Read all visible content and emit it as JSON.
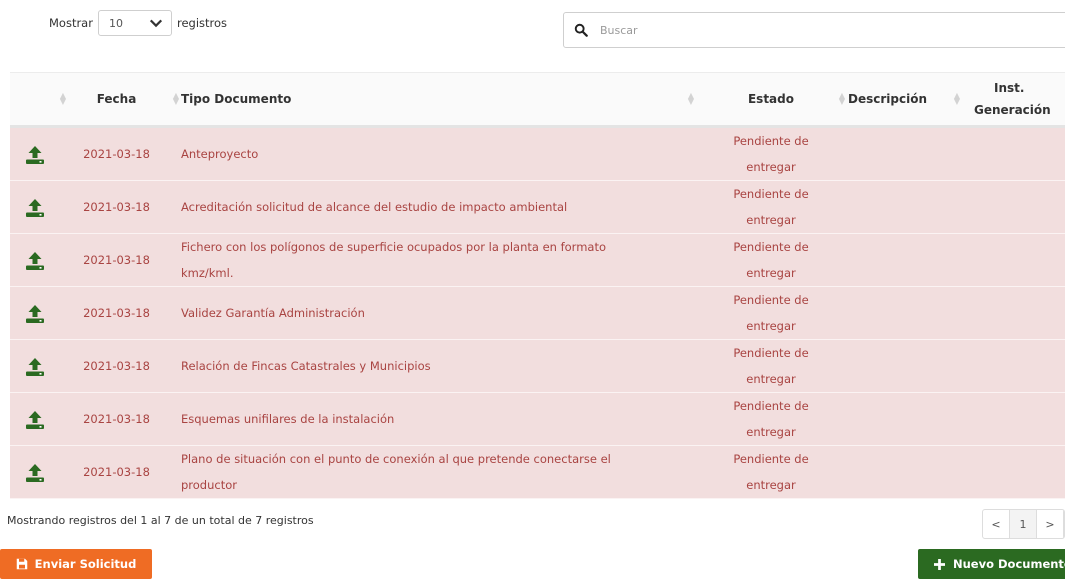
{
  "length_menu": {
    "prefix": "Mostrar",
    "value": "10",
    "suffix": "registros"
  },
  "search": {
    "placeholder": "Buscar"
  },
  "table": {
    "headers": {
      "fecha": "Fecha",
      "tipo": "Tipo Documento",
      "estado": "Estado",
      "descripcion": "Descripción",
      "inst_line1": "Inst.",
      "inst_line2": "Generación"
    },
    "rows": [
      {
        "fecha": "2021-03-18",
        "tipo": "Anteproyecto",
        "estado_l1": "Pendiente de",
        "estado_l2": "entregar"
      },
      {
        "fecha": "2021-03-18",
        "tipo": "Acreditación solicitud de alcance del estudio de impacto ambiental",
        "estado_l1": "Pendiente de",
        "estado_l2": "entregar"
      },
      {
        "fecha": "2021-03-18",
        "tipo_l1": "Fichero con los polígonos de superficie ocupados por la planta en formato",
        "tipo_l2": "kmz/kml.",
        "estado_l1": "Pendiente de",
        "estado_l2": "entregar"
      },
      {
        "fecha": "2021-03-18",
        "tipo": "Validez Garantía Administración",
        "estado_l1": "Pendiente de",
        "estado_l2": "entregar"
      },
      {
        "fecha": "2021-03-18",
        "tipo": "Relación de Fincas Catastrales y Municipios",
        "estado_l1": "Pendiente de",
        "estado_l2": "entregar"
      },
      {
        "fecha": "2021-03-18",
        "tipo": "Esquemas unifilares de la instalación",
        "estado_l1": "Pendiente de",
        "estado_l2": "entregar"
      },
      {
        "fecha": "2021-03-18",
        "tipo_l1": "Plano de situación con el punto de conexión al que pretende conectarse el",
        "tipo_l2": "productor",
        "estado_l1": "Pendiente de",
        "estado_l2": "entregar"
      }
    ]
  },
  "info": "Mostrando registros del 1 al 7 de un total de 7 registros",
  "pagination": {
    "prev": "<",
    "page": "1",
    "next": ">"
  },
  "buttons": {
    "send": "Enviar Solicitud",
    "new_doc": "Nuevo Documento"
  },
  "colors": {
    "row_bg": "#f2dede",
    "row_text": "#a94442",
    "upload_icon": "#2b6a21",
    "send_button": "#ef6c24",
    "new_button": "#2b6a21"
  },
  "icons": {
    "row_action": "upload-icon",
    "search": "search-icon",
    "dropdown": "chevron-down-icon",
    "send": "floppy-disk-icon",
    "new": "plus-icon"
  }
}
